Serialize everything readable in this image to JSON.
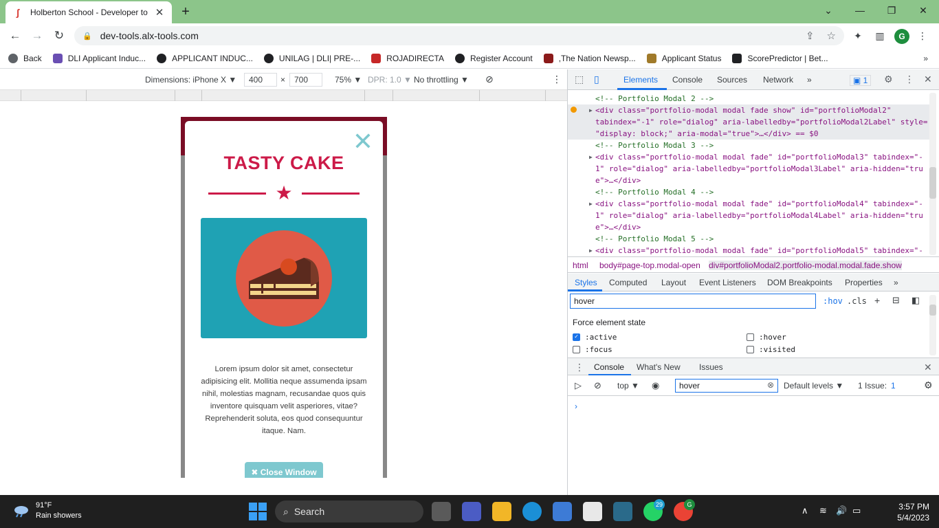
{
  "browser": {
    "tab_title": "Holberton School - Developer to",
    "tab_close": "✕",
    "new_tab": "+",
    "url": "dev-tools.alx-tools.com",
    "profile_initial": "G",
    "window_controls": {
      "minimize": "—",
      "maximize": "❐",
      "close": "✕",
      "tab_search": "⌄"
    }
  },
  "bookmarks": [
    {
      "label": "Back",
      "color": "#5f6368"
    },
    {
      "label": "DLI Applicant Induc...",
      "color": "#6a4fb3"
    },
    {
      "label": "APPLICANT INDUC...",
      "color": "#202124"
    },
    {
      "label": "UNILAG | DLI| PRE-...",
      "color": "#202124"
    },
    {
      "label": "ROJADIRECTA",
      "color": "#c62828"
    },
    {
      "label": "Register Account",
      "color": "#202124"
    },
    {
      "label": ",The Nation Newsp...",
      "color": "#8b1a1a"
    },
    {
      "label": "Applicant Status",
      "color": "#a07a2a"
    },
    {
      "label": "ScorePredictor | Bet...",
      "color": "#202124"
    }
  ],
  "bookmarks_more": "»",
  "device_bar": {
    "dimensions": "Dimensions: iPhone X ▼",
    "width": "400",
    "times": "×",
    "height": "700",
    "zoom": "75% ▼",
    "dpr": "DPR: 1.0 ▼",
    "throttle": "No throttling ▼"
  },
  "modal": {
    "title": "TASTY CAKE",
    "close_x": "✕",
    "star": "★",
    "body": "Lorem ipsum dolor sit amet, consectetur adipisicing elit. Mollitia neque assumenda ipsam nihil, molestias magnam, recusandae quos quis inventore quisquam velit asperiores, vitae? Reprehenderit soluta, eos quod consequuntur itaque. Nam.",
    "close_button": "✖ Close Window",
    "colors": {
      "title": "#cc1a48",
      "cake_bg": "#1fa2b4",
      "button": "#7ec8cf"
    }
  },
  "devtools": {
    "tabs": [
      "Elements",
      "Console",
      "Sources",
      "Network"
    ],
    "more_tabs": "»",
    "issues_count": "1",
    "dom_lines": [
      {
        "type": "comment",
        "text": "<!-- Portfolio Modal 2 -->"
      },
      {
        "type": "code",
        "text": "<div class=\"portfolio-modal modal fade show\" id=\"portfolioModal2\""
      },
      {
        "type": "code",
        "text": "tabindex=\"-1\" role=\"dialog\" aria-labelledby=\"portfolioModal2Label\" style="
      },
      {
        "type": "code",
        "text": "\"display: block;\" aria-modal=\"true\">…</div> == $0"
      },
      {
        "type": "comment",
        "text": "<!-- Portfolio Modal 3 -->"
      },
      {
        "type": "code",
        "text": "<div class=\"portfolio-modal modal fade\" id=\"portfolioModal3\" tabindex=\"-"
      },
      {
        "type": "code",
        "text": "1\" role=\"dialog\" aria-labelledby=\"portfolioModal3Label\" aria-hidden=\"tru"
      },
      {
        "type": "code",
        "text": "e\">…</div>"
      },
      {
        "type": "comment",
        "text": "<!-- Portfolio Modal 4 -->"
      },
      {
        "type": "code",
        "text": "<div class=\"portfolio-modal modal fade\" id=\"portfolioModal4\" tabindex=\"-"
      },
      {
        "type": "code",
        "text": "1\" role=\"dialog\" aria-labelledby=\"portfolioModal4Label\" aria-hidden=\"tru"
      },
      {
        "type": "code",
        "text": "e\">…</div>"
      },
      {
        "type": "comment",
        "text": "<!-- Portfolio Modal 5 -->"
      },
      {
        "type": "code",
        "text": "<div class=\"portfolio-modal modal fade\" id=\"portfolioModal5\" tabindex=\"-"
      }
    ],
    "breadcrumbs": [
      "html",
      "body#page-top.modal-open",
      "div#portfolioModal2.portfolio-modal.modal.fade.show"
    ],
    "sub_tabs": [
      "Styles",
      "Computed",
      "Layout",
      "Event Listeners",
      "DOM Breakpoints",
      "Properties"
    ],
    "filter_value": "hover",
    "hov": ":hov",
    "cls": ".cls",
    "force_title": "Force element state",
    "states": [
      {
        "label": ":active",
        "checked": true
      },
      {
        "label": ":hover",
        "checked": false
      },
      {
        "label": ":focus",
        "checked": false
      },
      {
        "label": ":visited",
        "checked": false
      }
    ],
    "drawer_tabs": [
      "Console",
      "What's New",
      "Issues"
    ],
    "console": {
      "context": "top ▼",
      "filter_value": "hover",
      "levels": "Default levels ▼",
      "issues": "1 Issue:",
      "issues_count": "1",
      "prompt": "›"
    }
  },
  "taskbar": {
    "temp": "91°F",
    "weather": "Rain showers",
    "search": "Search",
    "whatsapp_badge": "29",
    "time": "3:57 PM",
    "date": "5/4/2023"
  }
}
